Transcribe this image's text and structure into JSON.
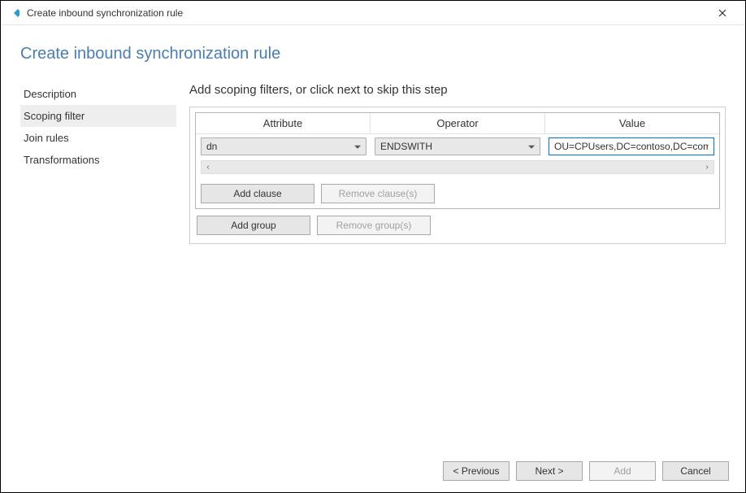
{
  "window": {
    "title": "Create inbound synchronization rule"
  },
  "page": {
    "heading": "Create inbound synchronization rule",
    "step_title": "Add scoping filters, or click next to skip this step"
  },
  "sidebar": {
    "items": [
      {
        "label": "Description",
        "active": false
      },
      {
        "label": "Scoping filter",
        "active": true
      },
      {
        "label": "Join rules",
        "active": false
      },
      {
        "label": "Transformations",
        "active": false
      }
    ]
  },
  "grid": {
    "headers": {
      "attribute": "Attribute",
      "operator": "Operator",
      "value": "Value"
    },
    "row": {
      "attribute": "dn",
      "operator": "ENDSWITH",
      "value": "OU=CPUsers,DC=contoso,DC=com"
    }
  },
  "buttons": {
    "add_clause": "Add clause",
    "remove_clause": "Remove clause(s)",
    "add_group": "Add group",
    "remove_group": "Remove group(s)"
  },
  "footer": {
    "previous": "< Previous",
    "next": "Next >",
    "add": "Add",
    "cancel": "Cancel"
  }
}
